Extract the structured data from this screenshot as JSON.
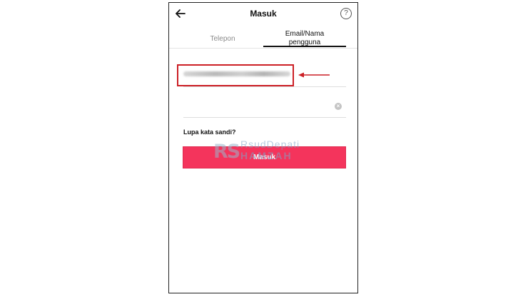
{
  "header": {
    "title": "Masuk",
    "back_icon": "arrow-left-icon",
    "help_icon": "question-circle-icon",
    "help_glyph": "?"
  },
  "tabs": [
    {
      "label": "Telepon",
      "active": false
    },
    {
      "label": "Email/Nama\npengguna",
      "active": true
    }
  ],
  "form": {
    "email_value": "",
    "password_value": "",
    "clear_icon": "clear-x-icon",
    "clear_glyph": "×",
    "forgot_label": "Lupa kata sandi?",
    "submit_label": "Masuk"
  },
  "annotation": {
    "highlight_color": "#cc1f25"
  },
  "watermark": {
    "logo": "RS",
    "line1": "RsudDepati",
    "line2": "HAMZAH"
  },
  "colors": {
    "accent": "#f4345c",
    "inactive_tab": "#8a8a8a"
  }
}
